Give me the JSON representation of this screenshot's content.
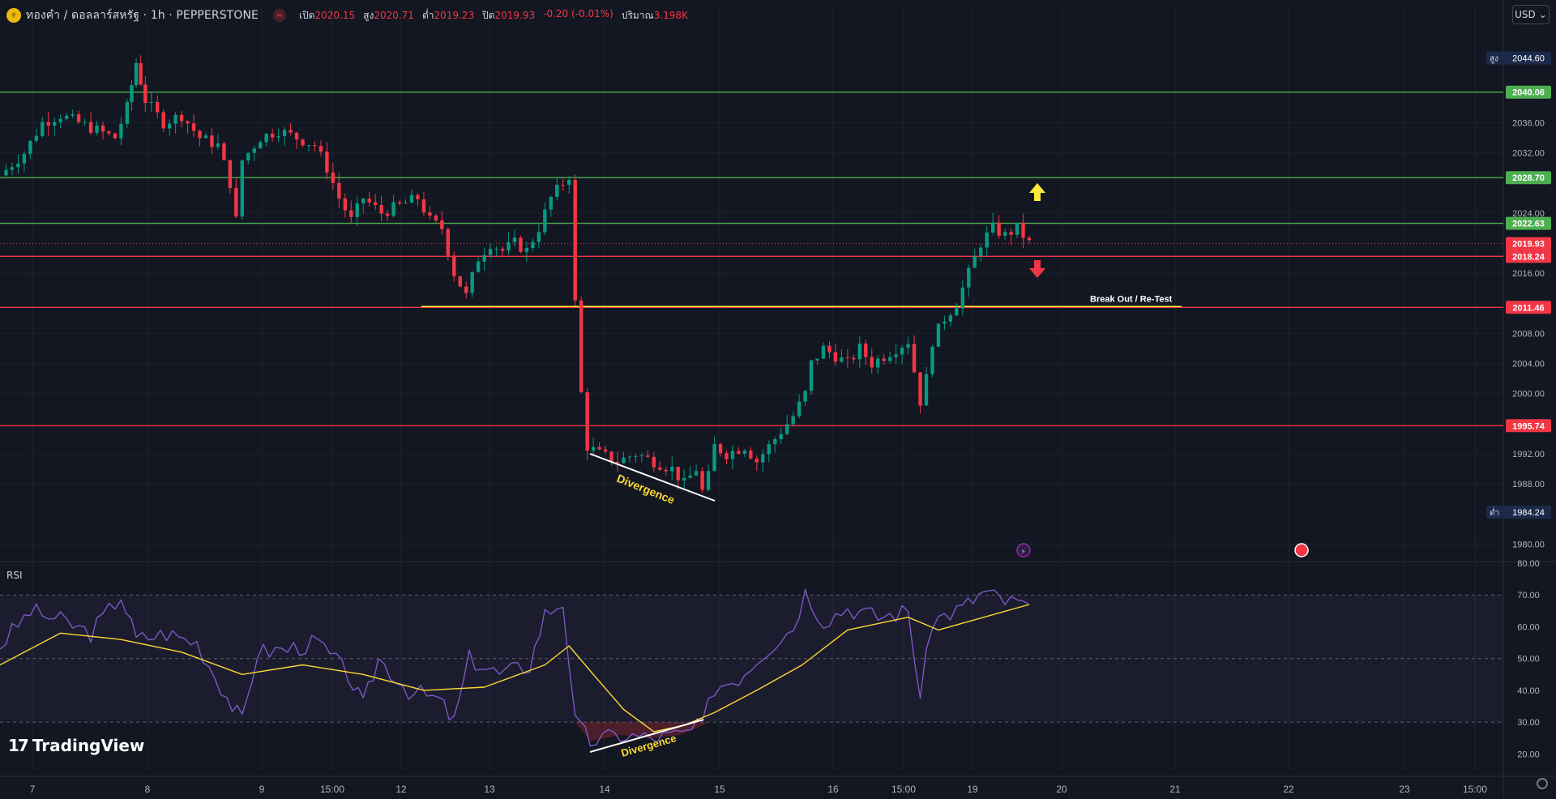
{
  "header": {
    "symbol_title": "ทองคำ / ดอลลาร์สหรัฐ · 1h · PEPPERSTONE",
    "ohlc": [
      {
        "label": "เปิด",
        "value": "2020.15"
      },
      {
        "label": "สูง",
        "value": "2020.71"
      },
      {
        "label": "ต่ำ",
        "value": "2019.23"
      },
      {
        "label": "ปิด",
        "value": "2019.93"
      },
      {
        "label": "",
        "value": "-0.20 (-0.01%)"
      },
      {
        "label": "ปริมาณ",
        "value": "3.198K"
      }
    ],
    "currency": "USD",
    "symbol_icon": "gold-coin-icon",
    "status_icon": "market-closed-icon"
  },
  "rsi_label": "RSI",
  "brand": "TradingView",
  "annotations": {
    "breakout": "Break Out / Re-Test",
    "divergence_price": "Divergence",
    "divergence_rsi": "Divergence"
  },
  "colors": {
    "background": "#131722",
    "up": "#089981",
    "down": "#f23645",
    "support_line": "#4caf50",
    "resistance_line": "#f23645",
    "trend_line": "#ffeb3b",
    "rsi_line": "#7e57c2",
    "rsi_ma": "#fdd835"
  },
  "chart_data": [
    {
      "type": "candlestick",
      "title": "",
      "x_ticks": [
        "7",
        "8",
        "9",
        "15:00",
        "12",
        "13",
        "14",
        "15",
        "16",
        "15:00",
        "19",
        "20",
        "21",
        "22",
        "23",
        "15:00"
      ],
      "y_ticks": [
        "2044.60",
        "2040.06",
        "2036.00",
        "2032.00",
        "2028.70",
        "2024.00",
        "2022.63",
        "2019.93",
        "2018.24",
        "2016.00",
        "2011.46",
        "2008.00",
        "2004.00",
        "2000.00",
        "1995.74",
        "1992.00",
        "1988.00",
        "1984.24",
        "1980.00"
      ],
      "ylim": [
        1978,
        2048
      ],
      "high_label": "สูง",
      "high_value": "2044.60",
      "low_label": "ต่ำ",
      "low_value": "1984.24",
      "levels": [
        {
          "value": 2040.06,
          "label": "2040.06",
          "kind": "support"
        },
        {
          "value": 2028.7,
          "label": "2028.70",
          "kind": "support"
        },
        {
          "value": 2022.63,
          "label": "2022.63",
          "kind": "support"
        },
        {
          "value": 2018.24,
          "label": "2018.24",
          "kind": "resistance"
        },
        {
          "value": 2011.46,
          "label": "2011.46",
          "kind": "resistance"
        },
        {
          "value": 1995.74,
          "label": "1995.74",
          "kind": "resistance"
        }
      ],
      "last_price": {
        "value": 2019.93,
        "label": "2019.93"
      },
      "price_path": [
        [
          0,
          2029
        ],
        [
          8,
          2032
        ],
        [
          14,
          2036
        ],
        [
          20,
          2037
        ],
        [
          26,
          2036
        ],
        [
          32,
          2035
        ],
        [
          38,
          2034
        ],
        [
          42,
          2038
        ],
        [
          45,
          2044
        ],
        [
          48,
          2039
        ],
        [
          54,
          2036
        ],
        [
          60,
          2037
        ],
        [
          66,
          2034
        ],
        [
          72,
          2033
        ],
        [
          76,
          2028
        ],
        [
          78,
          2023
        ],
        [
          80,
          2031
        ],
        [
          86,
          2034
        ],
        [
          92,
          2035
        ],
        [
          98,
          2034
        ],
        [
          104,
          2033
        ],
        [
          108,
          2030
        ],
        [
          112,
          2026
        ],
        [
          116,
          2023
        ],
        [
          120,
          2026
        ],
        [
          126,
          2024
        ],
        [
          132,
          2025
        ],
        [
          138,
          2026
        ],
        [
          142,
          2023
        ],
        [
          146,
          2022
        ],
        [
          150,
          2016
        ],
        [
          154,
          2013
        ],
        [
          158,
          2018
        ],
        [
          162,
          2020
        ],
        [
          166,
          2019
        ],
        [
          170,
          2020
        ],
        [
          174,
          2019
        ],
        [
          178,
          2022
        ],
        [
          182,
          2026
        ],
        [
          186,
          2028
        ],
        [
          188,
          2029
        ],
        [
          190,
          2012
        ],
        [
          192,
          2000
        ],
        [
          194,
          1993
        ],
        [
          198,
          1992
        ],
        [
          204,
          1991
        ],
        [
          210,
          1992
        ],
        [
          216,
          1991
        ],
        [
          222,
          1990
        ],
        [
          226,
          1988
        ],
        [
          230,
          1990
        ],
        [
          232,
          1987
        ],
        [
          234,
          1989
        ],
        [
          236,
          1993
        ],
        [
          240,
          1992
        ],
        [
          246,
          1993
        ],
        [
          250,
          1991
        ],
        [
          254,
          1993
        ],
        [
          258,
          1995
        ],
        [
          262,
          1997
        ],
        [
          266,
          2000
        ],
        [
          268,
          2004
        ],
        [
          272,
          2006
        ],
        [
          276,
          2005
        ],
        [
          280,
          2004
        ],
        [
          284,
          2006
        ],
        [
          288,
          2004
        ],
        [
          292,
          2005
        ],
        [
          296,
          2006
        ],
        [
          300,
          2007
        ],
        [
          304,
          1999
        ],
        [
          306,
          2002
        ],
        [
          308,
          2007
        ],
        [
          312,
          2010
        ],
        [
          316,
          2012
        ],
        [
          320,
          2016
        ],
        [
          324,
          2020
        ],
        [
          328,
          2022
        ],
        [
          332,
          2021
        ],
        [
          336,
          2022
        ],
        [
          340,
          2020
        ]
      ]
    },
    {
      "type": "line",
      "title": "RSI",
      "ylim": [
        15,
        80
      ],
      "y_ticks": [
        "80.00",
        "70.00",
        "60.00",
        "50.00",
        "40.00",
        "30.00",
        "20.00"
      ],
      "bands": [
        70,
        50,
        30
      ],
      "series": [
        {
          "values": [
            [
              0,
              54
            ],
            [
              10,
              65
            ],
            [
              20,
              62
            ],
            [
              30,
              58
            ],
            [
              40,
              70
            ],
            [
              45,
              56
            ],
            [
              55,
              58
            ],
            [
              65,
              55
            ],
            [
              75,
              38
            ],
            [
              80,
              30
            ],
            [
              85,
              52
            ],
            [
              95,
              53
            ],
            [
              105,
              55
            ],
            [
              115,
              45
            ],
            [
              120,
              35
            ],
            [
              125,
              50
            ],
            [
              135,
              40
            ],
            [
              145,
              37
            ],
            [
              150,
              30
            ],
            [
              155,
              50
            ],
            [
              165,
              45
            ],
            [
              175,
              48
            ],
            [
              180,
              64
            ],
            [
              186,
              68
            ],
            [
              190,
              30
            ],
            [
              195,
              24
            ],
            [
              205,
              26
            ],
            [
              215,
              25
            ],
            [
              225,
              26
            ],
            [
              232,
              29
            ],
            [
              236,
              41
            ],
            [
              244,
              44
            ],
            [
              252,
              52
            ],
            [
              262,
              60
            ],
            [
              266,
              71
            ],
            [
              272,
              62
            ],
            [
              280,
              66
            ],
            [
              290,
              63
            ],
            [
              300,
              65
            ],
            [
              304,
              38
            ],
            [
              308,
              62
            ],
            [
              318,
              66
            ],
            [
              325,
              71
            ],
            [
              332,
              68
            ],
            [
              340,
              67
            ]
          ]
        },
        {
          "values": [
            [
              0,
              48
            ],
            [
              20,
              58
            ],
            [
              40,
              56
            ],
            [
              60,
              52
            ],
            [
              80,
              45
            ],
            [
              100,
              48
            ],
            [
              120,
              45
            ],
            [
              140,
              40
            ],
            [
              160,
              41
            ],
            [
              180,
              48
            ],
            [
              188,
              54
            ],
            [
              196,
              45
            ],
            [
              206,
              34
            ],
            [
              216,
              27
            ],
            [
              226,
              29
            ],
            [
              236,
              33
            ],
            [
              250,
              40
            ],
            [
              265,
              48
            ],
            [
              280,
              59
            ],
            [
              300,
              63
            ],
            [
              310,
              59
            ],
            [
              325,
              63
            ],
            [
              340,
              67
            ]
          ]
        }
      ]
    }
  ]
}
